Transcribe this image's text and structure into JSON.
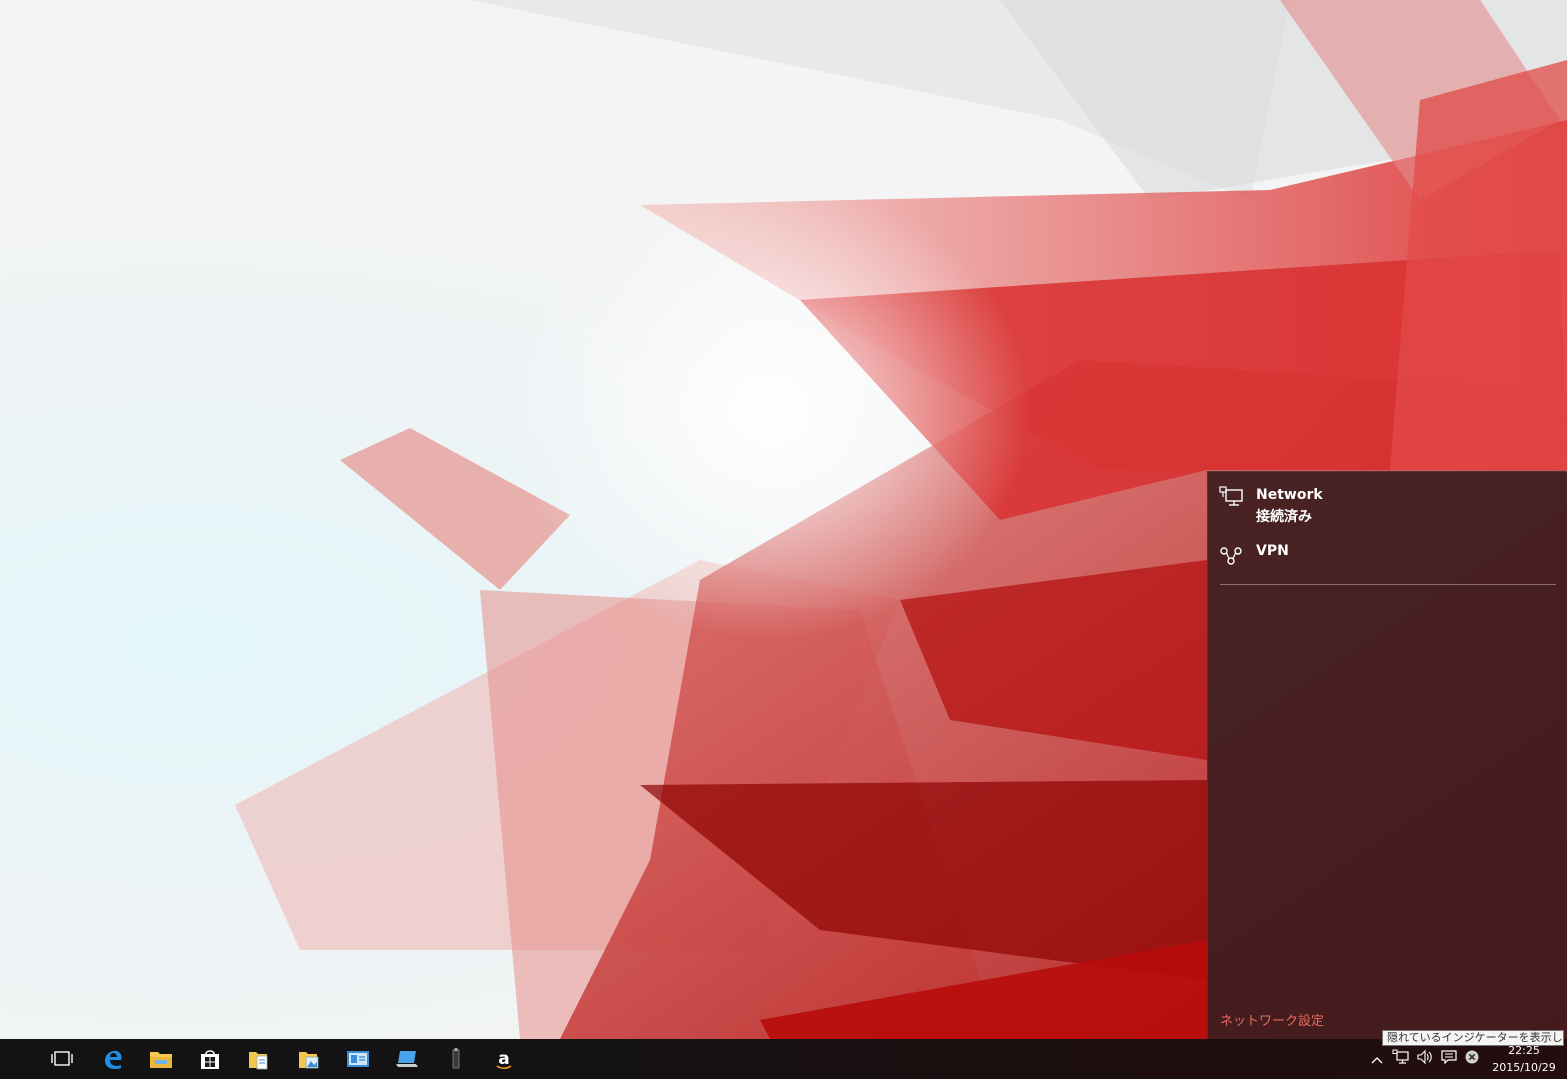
{
  "network_flyout": {
    "items": [
      {
        "title": "Network",
        "status": "接続済み",
        "icon": "wired-network-icon"
      },
      {
        "title": "VPN",
        "icon": "vpn-icon"
      }
    ],
    "settings_link": "ネットワーク設定"
  },
  "taskbar": {
    "pinned": [
      {
        "name": "task-view-button",
        "icon": "task-view-icon"
      },
      {
        "name": "edge-button",
        "icon": "edge-icon"
      },
      {
        "name": "file-explorer-button",
        "icon": "folder-icon"
      },
      {
        "name": "store-button",
        "icon": "store-icon"
      },
      {
        "name": "documents-button",
        "icon": "documents-folder-icon"
      },
      {
        "name": "pictures-button",
        "icon": "pictures-folder-icon"
      },
      {
        "name": "control-panel-button",
        "icon": "control-panel-icon"
      },
      {
        "name": "laptop-app-button",
        "icon": "laptop-icon"
      },
      {
        "name": "device-app-button",
        "icon": "usb-drive-icon"
      },
      {
        "name": "amazon-button",
        "icon": "amazon-icon"
      }
    ],
    "tray": {
      "tooltip": "隠れているインジケーターを表示します",
      "time": "22:25",
      "date": "2015/10/29"
    }
  },
  "colors": {
    "flyout_bg": "#3a1c1e",
    "accent_link": "#e86a5e",
    "wallpaper_red": "#c80f0f"
  }
}
